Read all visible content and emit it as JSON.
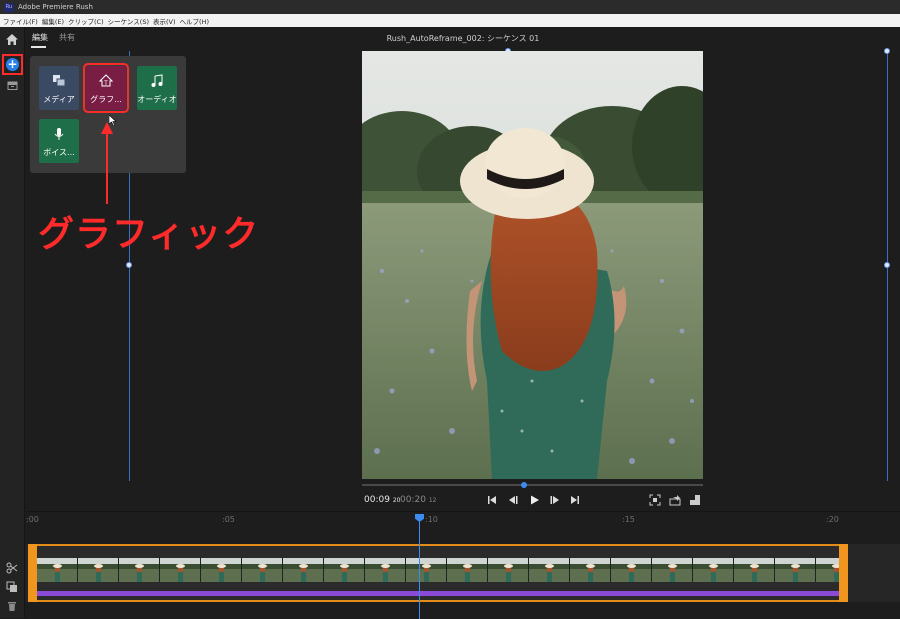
{
  "app": {
    "title": "Adobe Premiere Rush",
    "icon_text": "Ru"
  },
  "menu": [
    "ファイル(F)",
    "編集(E)",
    "クリップ(C)",
    "シーケンス(S)",
    "表示(V)",
    "ヘルプ(H)"
  ],
  "tabs": {
    "edit": "編集",
    "share": "共有"
  },
  "sequence_title": "Rush_AutoReframe_002: シーケンス 01",
  "add_menu": {
    "tiles": [
      {
        "label": "メディア",
        "color": "#3b4a63"
      },
      {
        "label": "グラフ...",
        "color": "#7a1d45"
      },
      {
        "label": "オーディオ",
        "color": "#1f6e4a"
      },
      {
        "label": "ボイス...",
        "color": "#1f6e4a"
      }
    ]
  },
  "annotation": {
    "label": "グラフィック",
    "color": "#ff2a2a"
  },
  "playback": {
    "current_time": "00:09",
    "current_frames": "20",
    "duration": "00:20",
    "duration_frames": "12"
  },
  "ruler": {
    "labels": [
      ":00",
      ":05",
      ":10",
      ":15",
      ":20"
    ]
  },
  "colors": {
    "accent": "#2680eb",
    "clip_border": "#e28d1a",
    "audio": "#8b4bd8"
  }
}
